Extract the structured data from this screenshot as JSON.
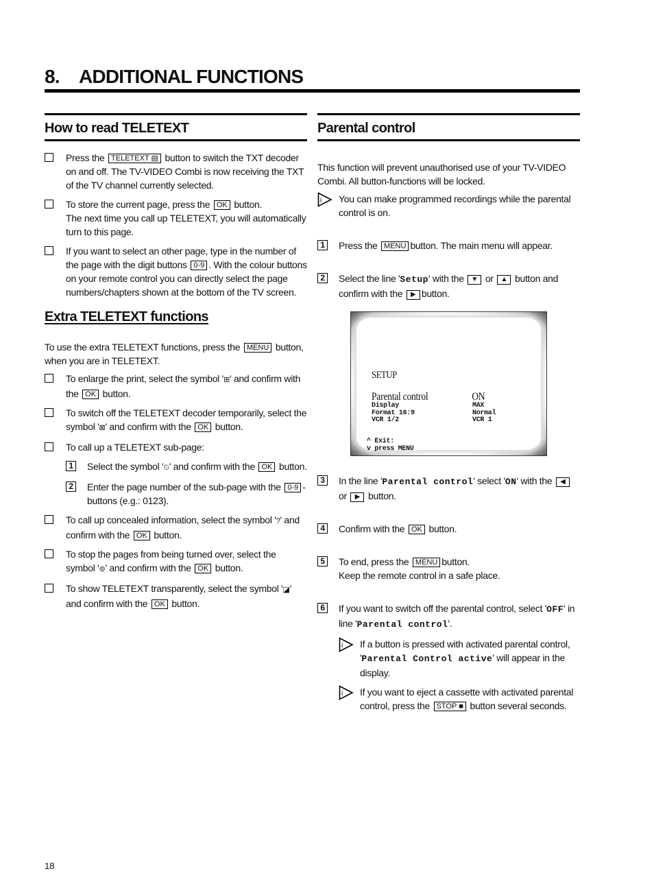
{
  "chapter": {
    "number": "8.",
    "title": "ADDITIONAL FUNCTIONS"
  },
  "left": {
    "heading": "How to read TELETEXT",
    "items": [
      {
        "pre": "Press the",
        "key": "TELETEXT ▤",
        "post": "button to switch the TXT decoder on and off. The TV-VIDEO Combi is now receiving the TXT of the TV channel currently selected."
      },
      {
        "pre": "To store the current page, press the",
        "key": "OK",
        "post": "button.",
        "line2": "The next time you call up TELETEXT, you will automatically turn to this page."
      },
      {
        "pre": "If you want to select an other page, type in the number of the page with the digit buttons",
        "key": "0-9",
        "post": ". With the colour buttons on your remote control you can directly select the page numbers/chapters shown at the bottom of the TV screen."
      }
    ],
    "extra_heading": "Extra TELETEXT functions",
    "extra_intro": {
      "pre": "To use the extra TELETEXT functions, press the",
      "key": "MENU",
      "post": "button, when you are in TELETEXT."
    },
    "extra_items": [
      {
        "pre": "To enlarge the print, select the symbol '",
        "sym": "⊞",
        "mid": "' and confirm with the",
        "key": "OK",
        "post": "button."
      },
      {
        "pre": "To switch off the TELETEXT decoder temporarily, select the symbol '",
        "sym": "⊠",
        "mid": "' and confirm with the",
        "key": "OK",
        "post": "button."
      },
      {
        "text": "To call up a TELETEXT sub-page:"
      },
      {
        "pre": "To call up concealed information, select the symbol '",
        "sym": "?",
        "mid": "' and confirm with the",
        "key": "OK",
        "post": "button."
      },
      {
        "pre": "To stop the pages from being turned over, select the symbol '",
        "sym": "⊜",
        "mid": "' and confirm with the",
        "key": "OK",
        "post": "button."
      },
      {
        "pre": "To show TELETEXT transparently, select the symbol '",
        "sym": "◪",
        "mid": "' and confirm with the",
        "key": "OK",
        "post": "button."
      }
    ],
    "subpage_steps": [
      {
        "num": "1",
        "pre": "Select the symbol '",
        "sym": "⏲",
        "mid": "' and confirm with the",
        "key": "OK",
        "post": "button."
      },
      {
        "num": "2",
        "pre": "Enter the page number of the sub-page with the",
        "key": "0-9",
        "post": "-buttons (e.g.: 0123)."
      }
    ]
  },
  "right": {
    "heading": "Parental control",
    "intro": "This function will prevent unauthorised use of your TV-VIDEO Combi. All button-functions will be locked.",
    "intro_note": "You can make programmed recordings while the parental control is on.",
    "steps": [
      {
        "num": "1",
        "pre": "Press the",
        "key": "MENU",
        "post": "button. The main menu will appear."
      },
      {
        "num": "2",
        "pre": "Select the line '",
        "mono": "Setup",
        "mid": "' with the",
        "key_a": "▼",
        "or": "or",
        "key_b": "▲",
        "post": "button and confirm with the",
        "key_c": "▶",
        "post2": "button."
      },
      {
        "num": "3",
        "pre": "In the line '",
        "mono": "Parental control",
        "mid": "' select '",
        "mono2": "ON",
        "mid2": "' with the",
        "key_a": "◀",
        "or": "or",
        "key_b": "▶",
        "post": "button."
      },
      {
        "num": "4",
        "pre": "Confirm with the",
        "key": "OK",
        "post": "button."
      },
      {
        "num": "5",
        "pre": "To end, press the",
        "key": "MENU",
        "post": "button.",
        "line2": "Keep the remote control in a safe place."
      },
      {
        "num": "6",
        "pre": "If you want to switch off the parental control, select '",
        "mono": "OFF",
        "mid": "' in line '",
        "mono2": "Parental control",
        "post": "'."
      }
    ],
    "notes": [
      {
        "pre": "If a button is pressed with activated parental control, '",
        "mono": "Parental Control active",
        "post": "' will appear in the display."
      },
      {
        "pre": "If you want to eject a cassette with activated parental control, press the",
        "key": "STOP ■",
        "post": "button several seconds."
      }
    ],
    "tv_screen": {
      "title": "SETUP",
      "highlight": {
        "label": "Parental control",
        "value": "ON"
      },
      "rows": [
        {
          "label": "Display",
          "value": "MAX"
        },
        {
          "label": "Format 16:9",
          "value": "Normal"
        },
        {
          "label": "VCR 1/2",
          "value": "VCR 1"
        }
      ],
      "footer": [
        "^ Exit:",
        "v press MENU"
      ]
    }
  },
  "page_number": "18"
}
